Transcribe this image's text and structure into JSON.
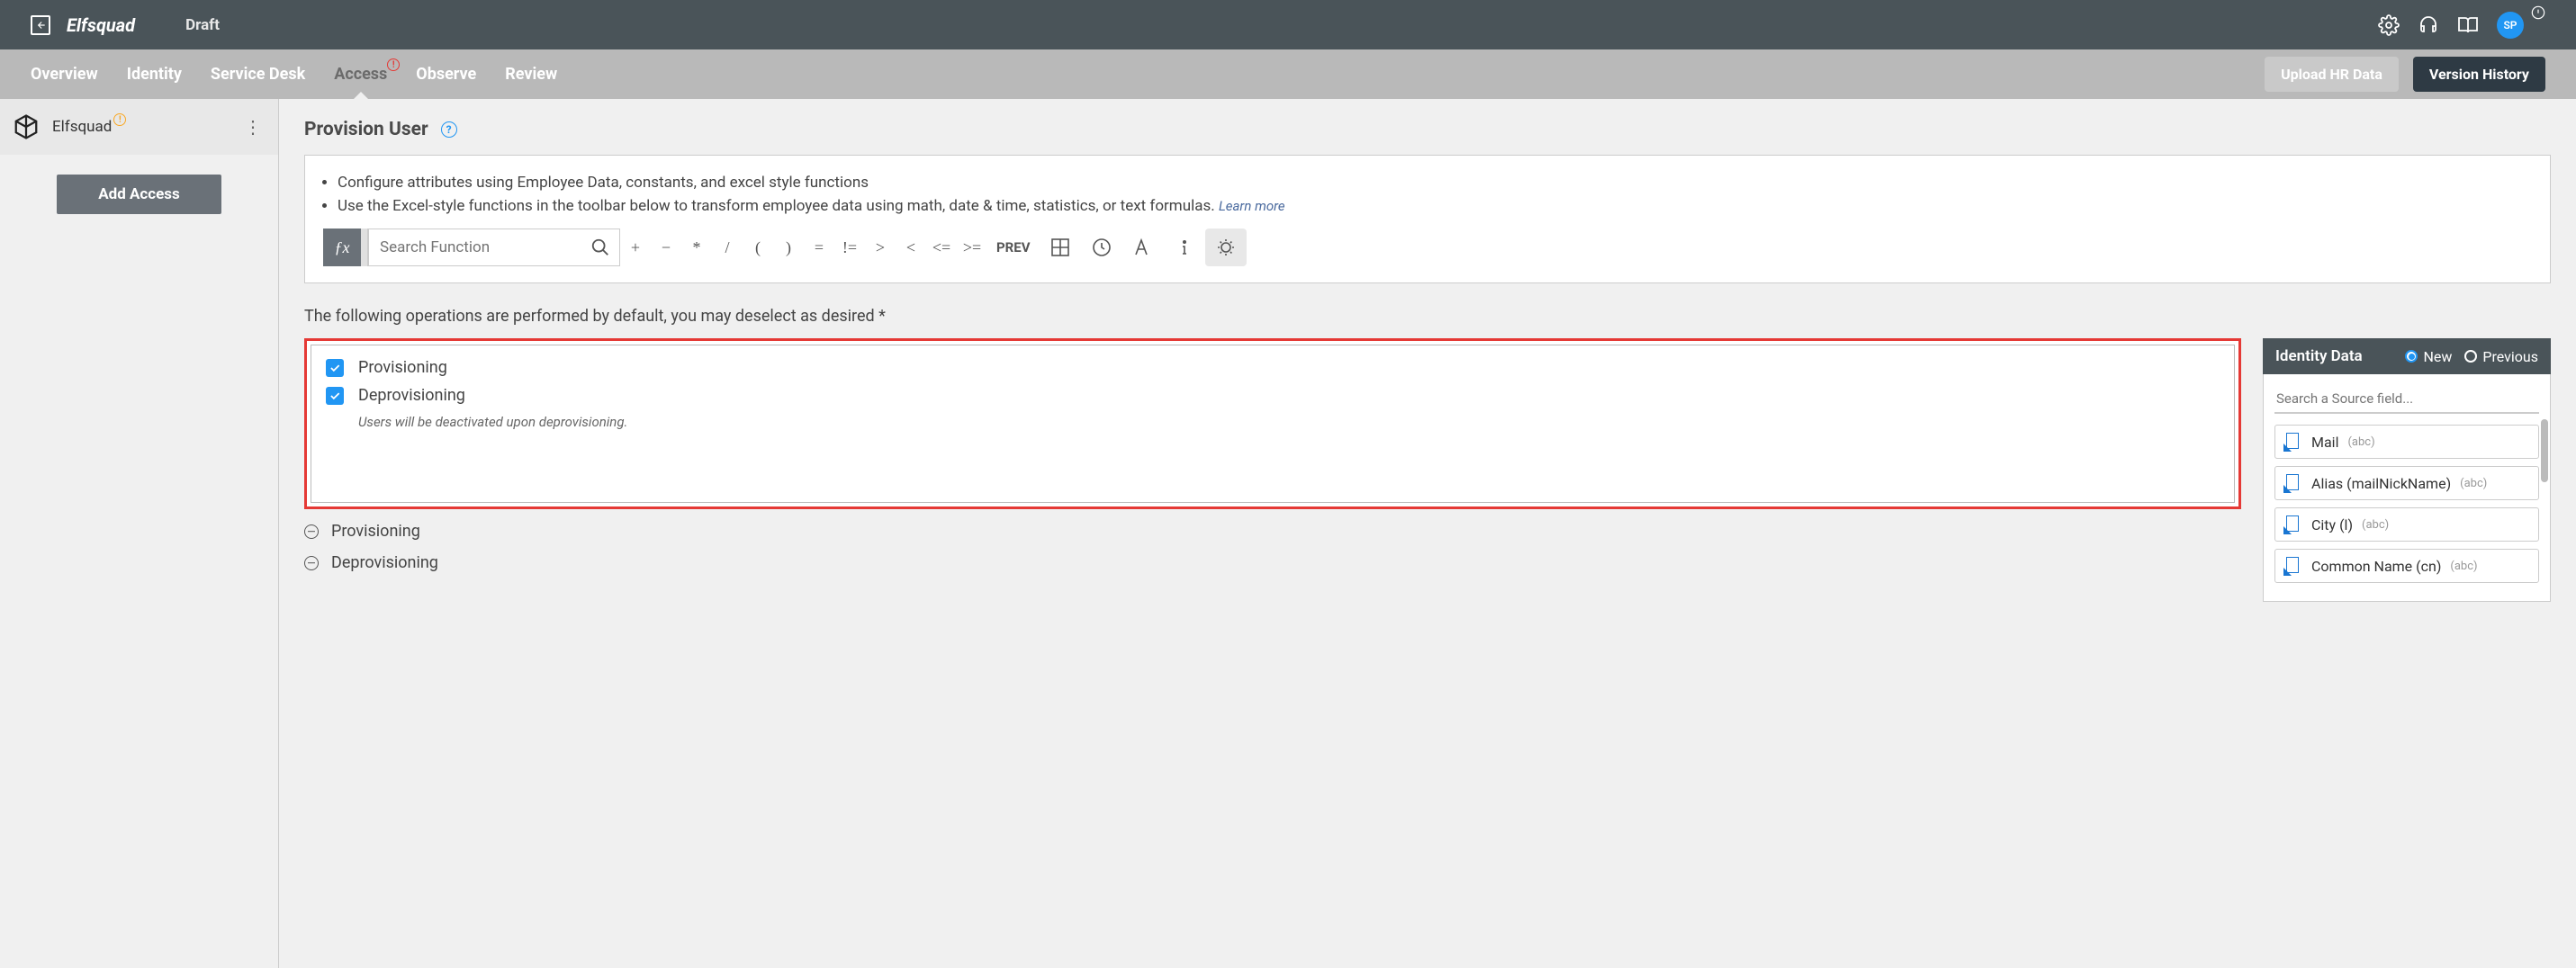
{
  "header": {
    "brand": "Elfsquad",
    "status": "Draft",
    "avatar": "SP"
  },
  "nav": {
    "items": [
      "Overview",
      "Identity",
      "Service Desk",
      "Access",
      "Observe",
      "Review"
    ],
    "active_index": 3,
    "upload_label": "Upload HR Data",
    "history_label": "Version History"
  },
  "sidebar": {
    "app_name": "Elfsquad",
    "add_access_label": "Add Access"
  },
  "main": {
    "title": "Provision User",
    "bullets": [
      "Configure attributes using Employee Data, constants, and excel style functions",
      "Use the Excel-style functions in the toolbar below to transform employee data using math, date & time, statistics, or text formulas."
    ],
    "learn_more": "Learn more",
    "search_placeholder": "Search Function",
    "operators": [
      "+",
      "−",
      "*",
      "/",
      "(",
      ")",
      "=",
      "!=",
      ">",
      "<",
      "<=",
      ">="
    ],
    "prev_label": "PREV",
    "ops_description": "The following operations are performed by default, you may deselect as desired *",
    "operations": [
      {
        "label": "Provisioning",
        "checked": true,
        "note": null
      },
      {
        "label": "Deprovisioning",
        "checked": true,
        "note": "Users will be deactivated upon deprovisioning."
      }
    ],
    "sections": [
      "Provisioning",
      "Deprovisioning"
    ]
  },
  "identity_panel": {
    "title": "Identity Data",
    "radio_new": "New",
    "radio_previous": "Previous",
    "search_placeholder": "Search a Source field...",
    "fields": [
      {
        "name": "Mail",
        "type": "(abc)"
      },
      {
        "name": "Alias (mailNickName)",
        "type": "(abc)"
      },
      {
        "name": "City (l)",
        "type": "(abc)"
      },
      {
        "name": "Common Name (cn)",
        "type": "(abc)"
      }
    ]
  }
}
